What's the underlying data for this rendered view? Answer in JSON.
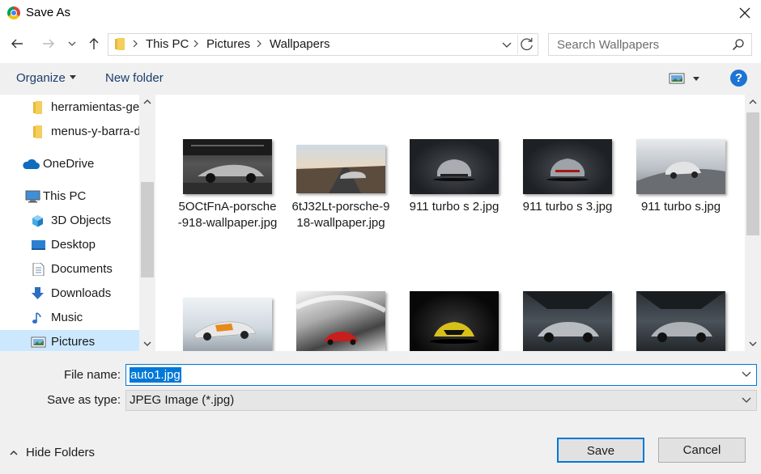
{
  "window": {
    "title": "Save As"
  },
  "address": {
    "crumbs": [
      "This PC",
      "Pictures",
      "Wallpapers"
    ]
  },
  "search": {
    "placeholder": "Search Wallpapers"
  },
  "toolbar": {
    "organize_label": "Organize",
    "new_folder_label": "New folder",
    "help_label": "?"
  },
  "sidebar": {
    "items": [
      {
        "label": "herramientas-ge",
        "icon": "folder-icon"
      },
      {
        "label": "menus-y-barra-d",
        "icon": "folder-icon"
      },
      {
        "label": "OneDrive",
        "icon": "cloud-icon"
      },
      {
        "label": "This PC",
        "icon": "computer-icon"
      },
      {
        "label": "3D Objects",
        "icon": "cube-icon"
      },
      {
        "label": "Desktop",
        "icon": "desktop-icon"
      },
      {
        "label": "Documents",
        "icon": "document-icon"
      },
      {
        "label": "Downloads",
        "icon": "download-icon"
      },
      {
        "label": "Music",
        "icon": "music-icon"
      },
      {
        "label": "Pictures",
        "icon": "pictures-icon",
        "selected": true
      }
    ]
  },
  "files": [
    {
      "name": "5OCtFnA-porsche-918-wallpaper.jpg"
    },
    {
      "name": "6tJ32Lt-porsche-918-wallpaper.jpg"
    },
    {
      "name": "911 turbo s 2.jpg"
    },
    {
      "name": "911 turbo s 3.jpg"
    },
    {
      "name": "911 turbo s.jpg"
    },
    {
      "name": ""
    },
    {
      "name": ""
    },
    {
      "name": ""
    },
    {
      "name": ""
    },
    {
      "name": ""
    }
  ],
  "form": {
    "file_name_label": "File name:",
    "file_name_value": "auto1.jpg",
    "save_as_type_label": "Save as type:",
    "save_as_type_value": "JPEG Image (*.jpg)"
  },
  "footer": {
    "hide_folders_label": "Hide Folders",
    "save_label": "Save",
    "cancel_label": "Cancel"
  },
  "colors": {
    "accent": "#0078d7",
    "selection": "#cce8ff",
    "toolbar_bg": "#f0f0f0",
    "help": "#1e74d3"
  }
}
